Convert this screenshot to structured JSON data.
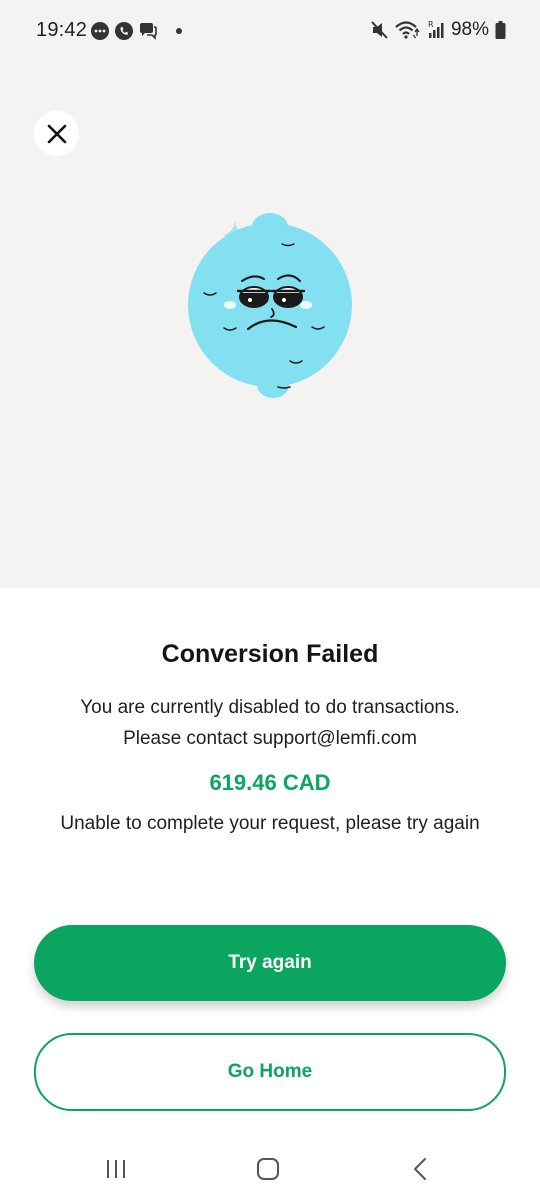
{
  "status_bar": {
    "time": "19:42",
    "battery": "98%",
    "left_icons": [
      "chat-bubble-icon",
      "whatsapp-icon",
      "messages-icon"
    ],
    "right_icons": [
      "mute-icon",
      "wifi-icon",
      "signal-icon",
      "battery-icon"
    ]
  },
  "header": {
    "close_icon": "close-icon"
  },
  "illustration": {
    "name": "sad-lemon-illustration",
    "color": "#83e0f0"
  },
  "content": {
    "title": "Conversion Failed",
    "message_line1": "You are currently disabled to do transactions.",
    "message_line2": "Please contact support@lemfi.com",
    "amount": "619.46 CAD",
    "sub_message": "Unable to complete your request, please try again"
  },
  "buttons": {
    "try_again": "Try again",
    "go_home": "Go Home"
  },
  "nav_bar": {
    "icons": [
      "recent-apps-icon",
      "home-icon",
      "back-icon"
    ]
  },
  "colors": {
    "accent": "#0aa55e",
    "top_background": "#f4f3f1",
    "lemon": "#83e0f0"
  }
}
